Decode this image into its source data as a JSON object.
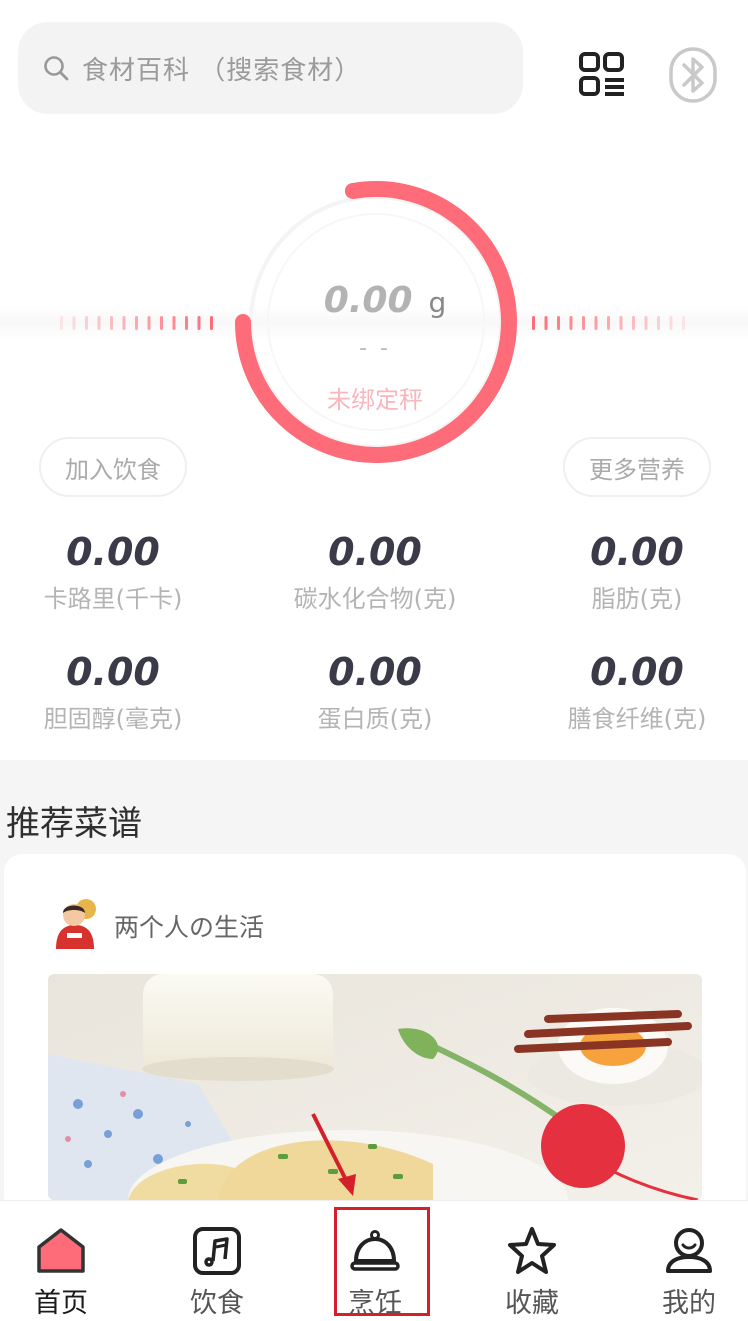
{
  "search": {
    "placeholder_text": "食材百科 （搜索食材）",
    "icon": "search-icon"
  },
  "header": {
    "scan_icon": "scan-icon",
    "bluetooth_icon": "bluetooth-icon"
  },
  "scale": {
    "weight": "0.00",
    "unit": "g",
    "sub": "- -",
    "status": "未绑定秤",
    "accent_color": "#fd6c78"
  },
  "actions": {
    "add_diet": "加入饮食",
    "more_nutrition": "更多营养"
  },
  "nutrition": [
    {
      "value": "0.00",
      "label": "卡路里(千卡)"
    },
    {
      "value": "0.00",
      "label": "碳水化合物(克)"
    },
    {
      "value": "0.00",
      "label": "脂肪(克)"
    },
    {
      "value": "0.00",
      "label": "胆固醇(毫克)"
    },
    {
      "value": "0.00",
      "label": "蛋白质(克)"
    },
    {
      "value": "0.00",
      "label": "膳食纤维(克)"
    }
  ],
  "recommend": {
    "title": "推荐菜谱",
    "author": "两个人の生活"
  },
  "tabs": [
    {
      "label": "首页",
      "icon": "home-icon",
      "active": true
    },
    {
      "label": "饮食",
      "icon": "diet-icon",
      "active": false
    },
    {
      "label": "烹饪",
      "icon": "cooking-cloche-icon",
      "active": false
    },
    {
      "label": "收藏",
      "icon": "star-icon",
      "active": false
    },
    {
      "label": "我的",
      "icon": "profile-icon",
      "active": false
    }
  ],
  "annotation": {
    "highlight_color": "#d3202a"
  }
}
